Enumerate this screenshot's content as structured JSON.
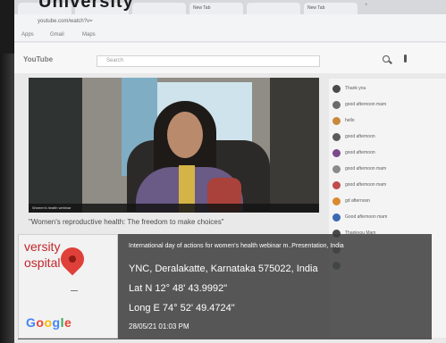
{
  "caption_top": "University",
  "browser": {
    "tabs": [
      "",
      "",
      "",
      "New Tab",
      "",
      "New Tab"
    ],
    "address": "youtube.com/watch?v=",
    "bookmarks": [
      "Apps",
      "Gmail",
      "Maps"
    ]
  },
  "youtube": {
    "logo": "YouTube",
    "search_placeholder": "Search"
  },
  "video": {
    "ticker": "Women's health webinar",
    "title": "\"Women's reproductive health: The freedom to make choices\""
  },
  "chat": {
    "messages": [
      {
        "text": "Thank you",
        "avatar_color": "#4a4a4a"
      },
      {
        "text": "good afternoon mam",
        "avatar_color": "#6b6b6b"
      },
      {
        "text": "hello",
        "avatar_color": "#c8893c"
      },
      {
        "text": "good afternoon",
        "avatar_color": "#5a5a5a"
      },
      {
        "text": "good afternoon",
        "avatar_color": "#7a4a8a"
      },
      {
        "text": "good afternoon mam",
        "avatar_color": "#8a8a8a"
      },
      {
        "text": "good afternoon mam",
        "avatar_color": "#c14a4a"
      },
      {
        "text": "gd afternoon",
        "avatar_color": "#d98a2c"
      },
      {
        "text": "Good afternoon mam",
        "avatar_color": "#3a6ab4"
      },
      {
        "text": "Thankyou Mam",
        "avatar_color": "#4a4a4a"
      },
      {
        "text": "",
        "avatar_color": "#6a6a6a"
      },
      {
        "text": "",
        "avatar_color": "#5a7a5a"
      }
    ]
  },
  "geotag": {
    "map_labels": [
      "versity",
      "ospital"
    ],
    "map_brand": "Google",
    "headline": "International day of actions for women's health webinar m..Presentation, India",
    "address": "YNC, Deralakatte, Karnataka 575022, India",
    "latitude": "Lat N 12° 48' 43.9992\"",
    "longitude": "Long E 74° 52' 49.4724\"",
    "datetime": "28/05/21 01:03 PM"
  },
  "colors": {
    "pin": "#e0403a",
    "overlay": "#3e3e3e",
    "map_label": "#c1272d"
  }
}
